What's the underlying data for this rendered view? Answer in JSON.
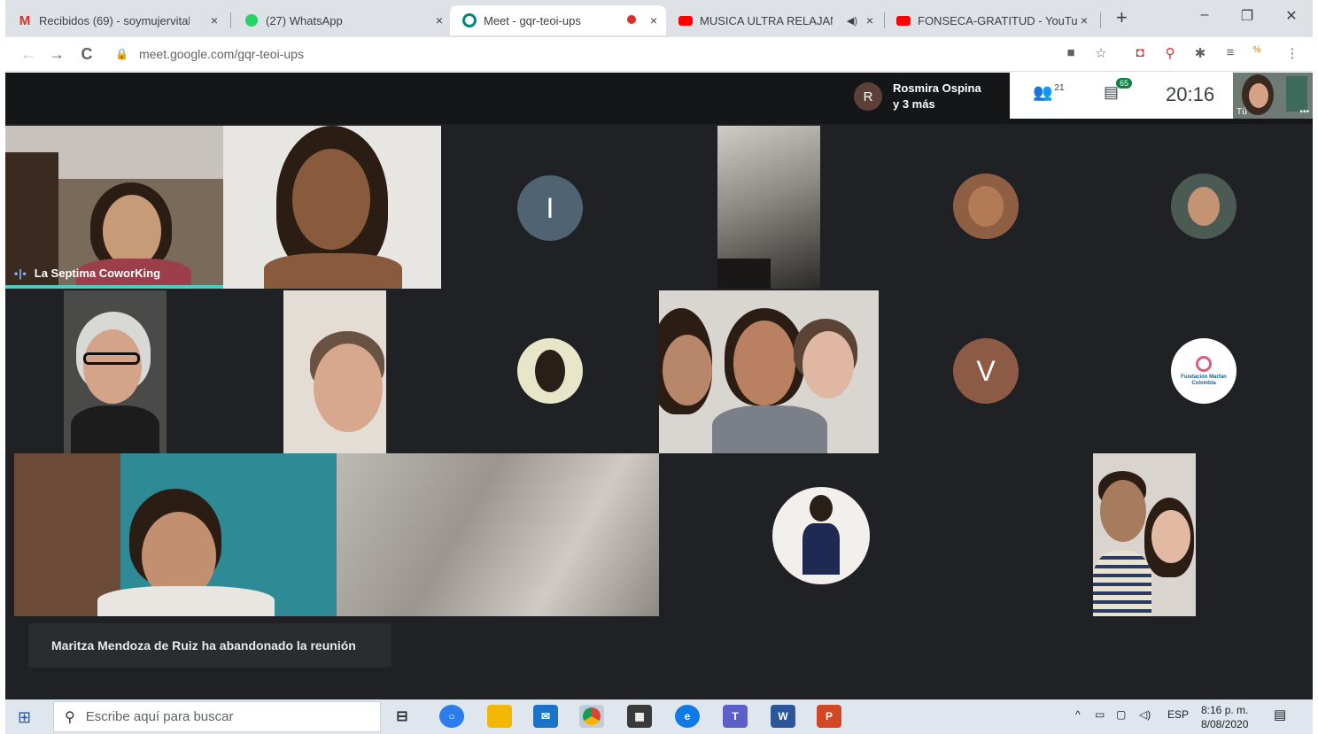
{
  "browser": {
    "tabs": [
      {
        "label": "Recibidos (69) - soymujervital",
        "icon": "gmail-icon"
      },
      {
        "label": "(27) WhatsApp",
        "icon": "whatsapp-icon"
      },
      {
        "label": "Meet - gqr-teoi-ups",
        "icon": "meet-icon",
        "active": true
      },
      {
        "label": "MUSICA ULTRA RELAJANT",
        "icon": "youtube-icon"
      },
      {
        "label": "FONSECA-GRATITUD - YouTub",
        "icon": "youtube-icon"
      }
    ],
    "close_glyph": "×",
    "new_tab_glyph": "+",
    "window_controls": {
      "minimize": "–",
      "maximize": "❐",
      "close": "✕"
    },
    "url": "meet.google.com/gqr-teoi-ups",
    "nav": {
      "back": "←",
      "forward": "→",
      "reload": "C"
    }
  },
  "meet": {
    "presenter": {
      "initial": "R",
      "name_line1": "Rosmira Ospina",
      "name_line2": "y 3 más"
    },
    "participants_count": "21",
    "chat_badge": "65",
    "time": "20:16",
    "self_label": "Tú",
    "speaking_tile_name": "La Septima CoworKing",
    "avatars": {
      "i": "I",
      "v": "V"
    },
    "logo_text": "Fundación Marfan Colombia",
    "toast": "Maritza Mendoza de Ruiz ha abandonado la reunión",
    "colors": {
      "avatar_i": "#4f6373",
      "avatar_v": "#8d5a46",
      "speaking": "#4ecdc4",
      "chat_badge": "#0b8043"
    }
  },
  "taskbar": {
    "search_placeholder": "Escribe aquí para buscar",
    "lang": "ESP",
    "time": "8:16 p. m.",
    "date": "8/08/2020"
  }
}
